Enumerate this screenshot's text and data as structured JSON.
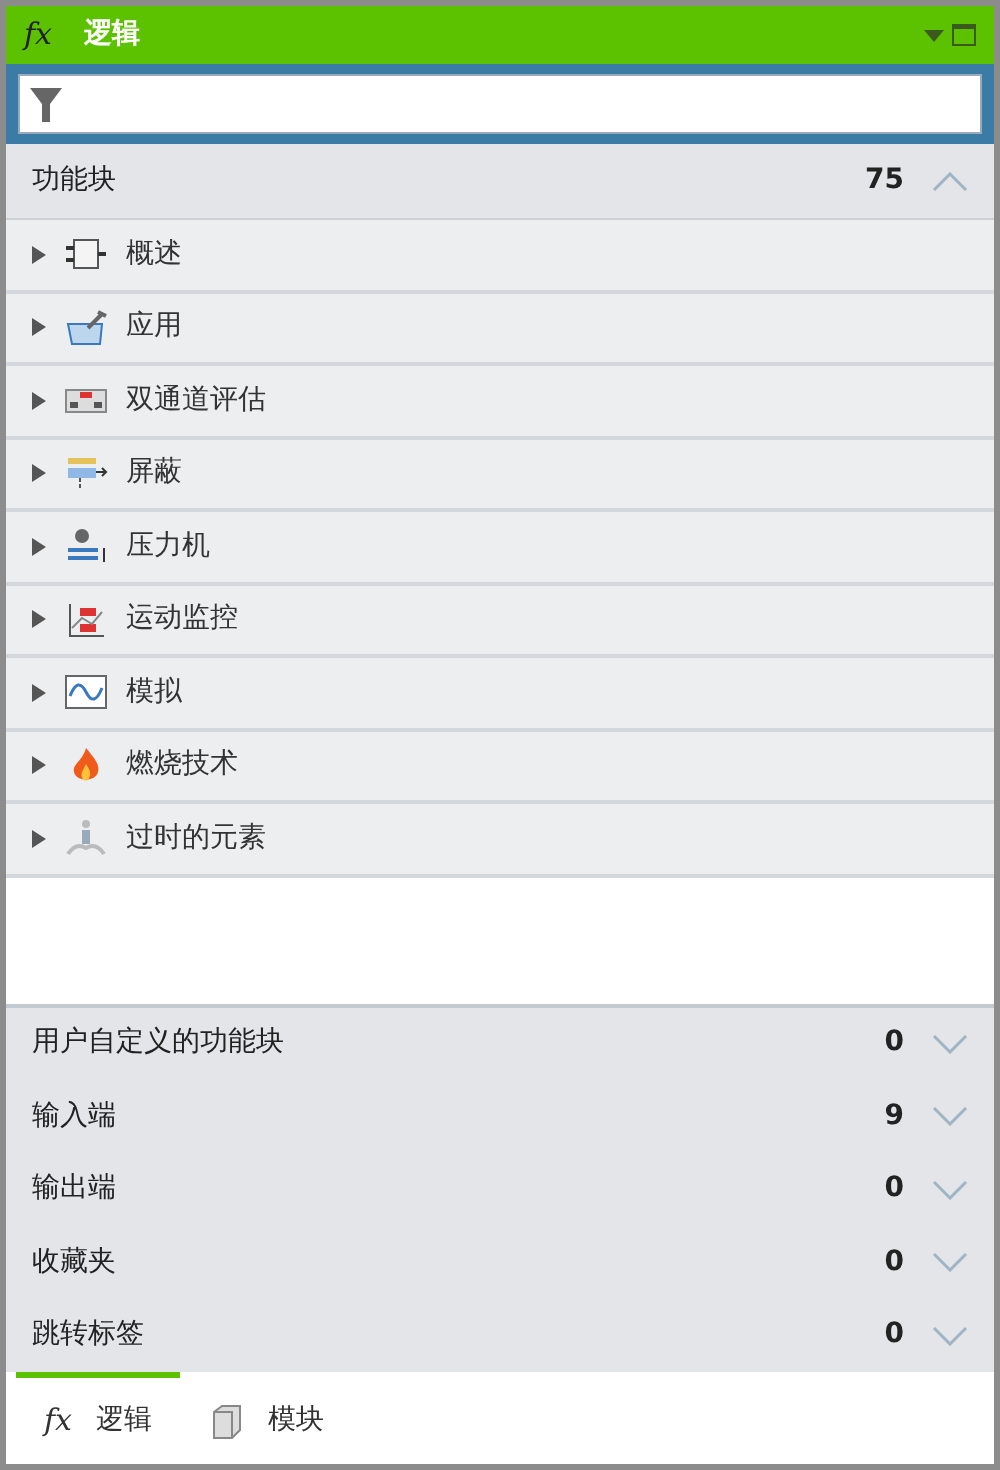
{
  "window": {
    "icon": "fx",
    "title": "逻辑"
  },
  "library": {
    "title": "功能块",
    "count": "75",
    "expanded": true,
    "items": [
      {
        "label": "概述",
        "expanded": false
      },
      {
        "label": "应用",
        "expanded": false
      },
      {
        "label": "双通道评估",
        "expanded": false
      },
      {
        "label": "屏蔽",
        "expanded": false
      },
      {
        "label": "压力机",
        "expanded": false
      },
      {
        "label": "运动监控",
        "expanded": false
      },
      {
        "label": "模拟",
        "expanded": false
      },
      {
        "label": "燃烧技术",
        "expanded": false
      },
      {
        "label": "过时的元素",
        "expanded": false
      }
    ]
  },
  "sections": [
    {
      "title": "用户自定义的功能块",
      "count": "0",
      "expanded": false
    },
    {
      "title": "输入端",
      "count": "9",
      "expanded": false
    },
    {
      "title": "输出端",
      "count": "0",
      "expanded": false
    },
    {
      "title": "收藏夹",
      "count": "0",
      "expanded": false
    },
    {
      "title": "跳转标签",
      "count": "0",
      "expanded": false
    }
  ],
  "tabs": [
    {
      "label": "逻辑",
      "icon": "fx",
      "selected": true
    },
    {
      "label": "模块",
      "selected": false
    }
  ]
}
